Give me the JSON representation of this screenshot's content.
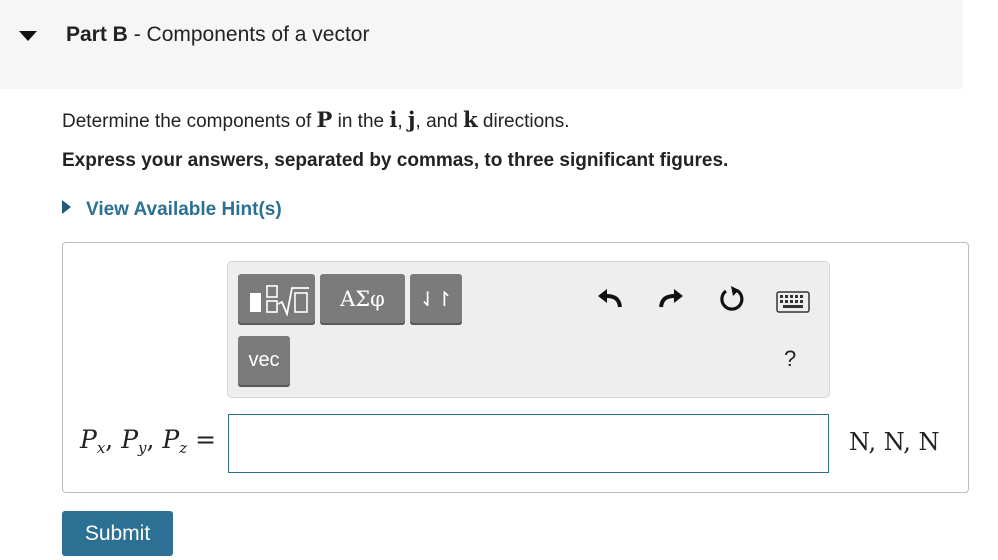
{
  "header": {
    "part_label": "Part B",
    "separator": " - ",
    "part_title": "Components of a vector"
  },
  "question": {
    "prefix": "Determine the components of ",
    "vector": "P",
    "mid1": " in the ",
    "unit_i": "i",
    "comma1": ", ",
    "unit_j": "j",
    "mid2": ", and ",
    "unit_k": "k",
    "suffix": " directions."
  },
  "instruction": "Express your answers, separated by commas, to three significant figures.",
  "hint_link": "View Available Hint(s)",
  "toolbar": {
    "greek_label": "ΑΣφ",
    "arrows_label": "⇃↾",
    "vec_label": "vec",
    "help_label": "?",
    "icons": [
      "templates-icon",
      "undo-icon",
      "redo-icon",
      "reset-icon",
      "keyboard-icon"
    ]
  },
  "answer": {
    "label_p1": "P",
    "sub1": "x",
    "label_p2": "P",
    "sub2": "y",
    "label_p3": "P",
    "sub3": "z",
    "equals": " =",
    "value": "",
    "units": "N, N, N"
  },
  "submit_label": "Submit",
  "colors": {
    "accent": "#2c7093",
    "header_bg": "#f6f6f6",
    "tool_button": "#7b7b7b",
    "toolbar_bg": "#eeeeee"
  }
}
